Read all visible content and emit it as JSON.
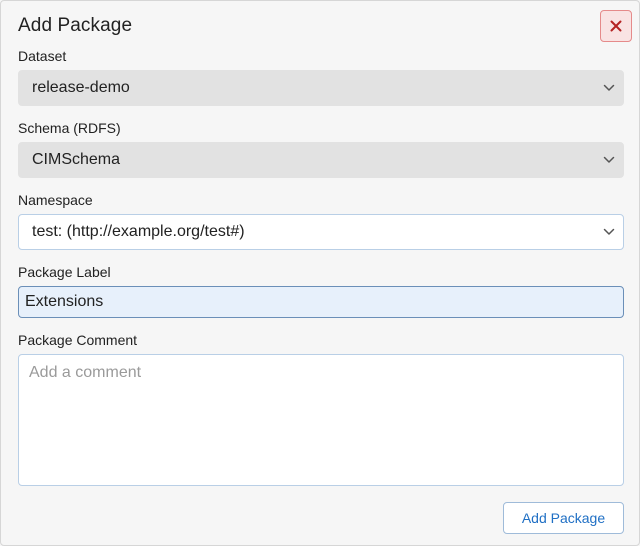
{
  "dialog": {
    "title": "Add Package",
    "close_icon": "close-icon",
    "fields": {
      "dataset": {
        "label": "Dataset",
        "value": "release-demo"
      },
      "schema": {
        "label": "Schema (RDFS)",
        "value": "CIMSchema"
      },
      "namespace": {
        "label": "Namespace",
        "value": "test: (http://example.org/test#)"
      },
      "package_label": {
        "label": "Package Label",
        "value": "Extensions"
      },
      "package_comment": {
        "label": "Package Comment",
        "placeholder": "Add a comment",
        "value": ""
      }
    },
    "submit_label": "Add Package"
  },
  "colors": {
    "close_accent": "#b42323",
    "primary_blue": "#1f6fc4",
    "disabled_bg": "#e2e2e2"
  }
}
